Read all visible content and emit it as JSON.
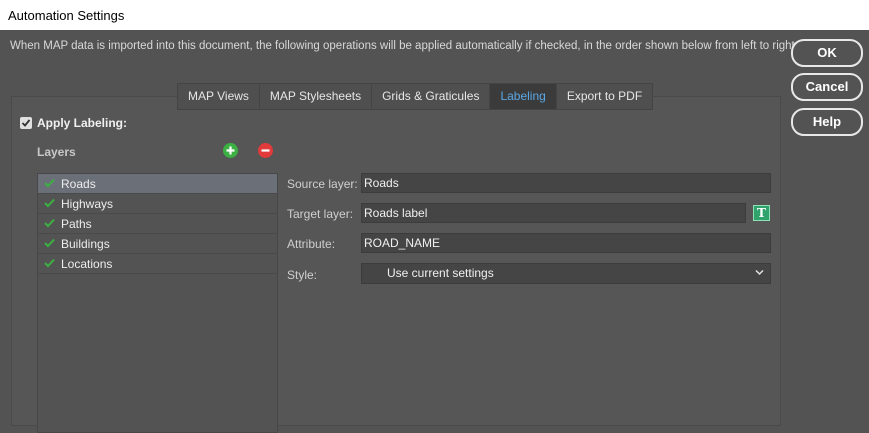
{
  "window": {
    "title": "Automation Settings"
  },
  "intro_text": "When MAP data is imported into this document, the following operations will be applied automatically if checked, in the order shown below from left to right.",
  "buttons": {
    "ok": "OK",
    "cancel": "Cancel",
    "help": "Help"
  },
  "tabs": [
    {
      "label": "MAP Views",
      "active": false
    },
    {
      "label": "MAP Stylesheets",
      "active": false
    },
    {
      "label": "Grids & Graticules",
      "active": false
    },
    {
      "label": "Labeling",
      "active": true
    },
    {
      "label": "Export to PDF",
      "active": false
    }
  ],
  "apply_labeling": {
    "label": "Apply Labeling:",
    "checked": true
  },
  "layers": {
    "title": "Layers",
    "items": [
      {
        "label": "Roads",
        "checked": true,
        "selected": true
      },
      {
        "label": "Highways",
        "checked": true,
        "selected": false
      },
      {
        "label": "Paths",
        "checked": true,
        "selected": false
      },
      {
        "label": "Buildings",
        "checked": true,
        "selected": false
      },
      {
        "label": "Locations",
        "checked": true,
        "selected": false
      }
    ]
  },
  "form": {
    "source_layer_label": "Source layer:",
    "source_layer_value": "Roads",
    "target_layer_label": "Target layer:",
    "target_layer_value": "Roads label",
    "attribute_label": "Attribute:",
    "attribute_value": "ROAD_NAME",
    "style_label": "Style:",
    "style_value": "Use current settings"
  },
  "colors": {
    "background": "#535353",
    "active_tab_text": "#5aa7e6",
    "add_button": "#3cb043",
    "remove_button": "#e03a3a",
    "check": "#3cb043",
    "text_icon": "#2fa36b"
  }
}
